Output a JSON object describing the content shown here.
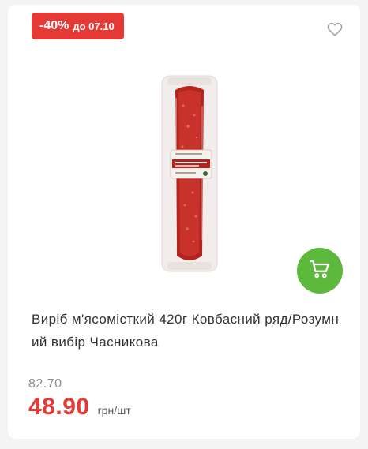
{
  "badge": {
    "discount": "-40%",
    "until": "до 07.10",
    "color": "#e53935"
  },
  "icons": {
    "favorite": "heart-outline-icon",
    "cart": "shopping-cart-icon"
  },
  "product": {
    "title": "Виріб м'ясомісткий 420г Ковбасний ряд/Розумний вибір Часникова",
    "image_alt": "Ковбаса в упаковці",
    "old_price": "82.70",
    "price": "48.90",
    "unit": "грн/шт"
  },
  "colors": {
    "accent_red": "#e53935",
    "cart_green": "#5cb93c"
  }
}
